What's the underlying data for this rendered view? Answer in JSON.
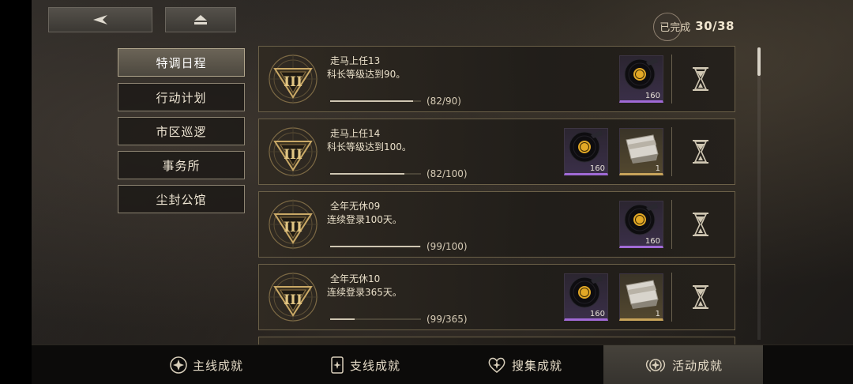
{
  "progress": {
    "label": "已完成",
    "count": "30/38"
  },
  "categories": [
    {
      "label": "特调日程",
      "active": true
    },
    {
      "label": "行动计划",
      "active": false
    },
    {
      "label": "市区巡逻",
      "active": false
    },
    {
      "label": "事务所",
      "active": false
    },
    {
      "label": "尘封公馆",
      "active": false
    }
  ],
  "achievements": [
    {
      "title": "走马上任13",
      "desc": "科长等级达到90。",
      "progress_text": "(82/90)",
      "progress": 0.911,
      "rewards": [
        {
          "icon": "vinyl-record-icon",
          "count": "160",
          "rarity": "purple"
        }
      ]
    },
    {
      "title": "走马上任14",
      "desc": "科长等级达到100。",
      "progress_text": "(82/100)",
      "progress": 0.82,
      "rewards": [
        {
          "icon": "vinyl-record-icon",
          "count": "160",
          "rarity": "purple"
        },
        {
          "icon": "ticket-card-icon",
          "count": "1",
          "rarity": "gold"
        }
      ]
    },
    {
      "title": "全年无休09",
      "desc": "连续登录100天。",
      "progress_text": "(99/100)",
      "progress": 0.99,
      "rewards": [
        {
          "icon": "vinyl-record-icon",
          "count": "160",
          "rarity": "purple"
        }
      ]
    },
    {
      "title": "全年无休10",
      "desc": "连续登录365天。",
      "progress_text": "(99/365)",
      "progress": 0.271,
      "rewards": [
        {
          "icon": "vinyl-record-icon",
          "count": "160",
          "rarity": "purple"
        },
        {
          "icon": "ticket-card-icon",
          "count": "1",
          "rarity": "gold"
        }
      ]
    }
  ],
  "bottom_tabs": [
    {
      "label": "主线成就",
      "icon": "shield-star-icon",
      "active": false
    },
    {
      "label": "支线成就",
      "icon": "scroll-star-icon",
      "active": false
    },
    {
      "label": "搜集成就",
      "icon": "heart-star-icon",
      "active": false
    },
    {
      "label": "活动成就",
      "icon": "winged-star-icon",
      "active": true
    }
  ]
}
